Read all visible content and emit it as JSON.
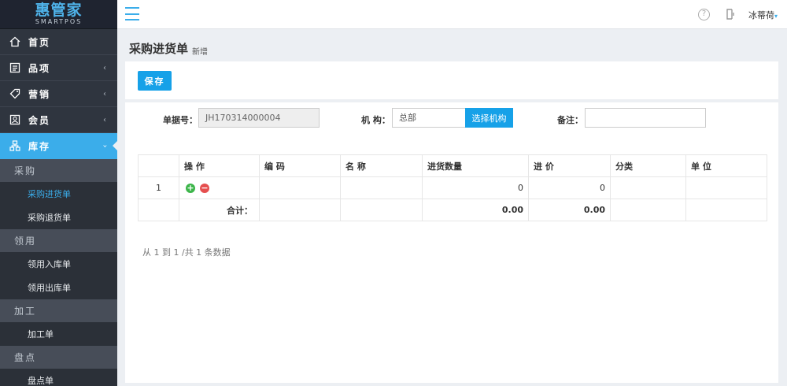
{
  "logo": {
    "main": "惠管家",
    "sub": "SMARTPOS"
  },
  "sidebar": {
    "items": [
      {
        "label": "首页",
        "icon": "home-icon",
        "arrow": ""
      },
      {
        "label": "品项",
        "icon": "list-icon",
        "arrow": "‹"
      },
      {
        "label": "营销",
        "icon": "tag-icon",
        "arrow": "‹"
      },
      {
        "label": "会员",
        "icon": "member-card-icon",
        "arrow": "‹"
      },
      {
        "label": "库存",
        "icon": "inventory-icon",
        "arrow": "›"
      }
    ],
    "inventory_menu": [
      {
        "group": "采购",
        "items": [
          "采购进货单",
          "采购退货单"
        ]
      },
      {
        "group": "领用",
        "items": [
          "领用入库单",
          "领用出库单"
        ]
      },
      {
        "group": "加工",
        "items": [
          "加工单"
        ]
      },
      {
        "group": "盘点",
        "items": [
          "盘点单"
        ]
      }
    ]
  },
  "topbar": {
    "user": "冰蒂荷",
    "help_glyph": "?"
  },
  "page": {
    "title": "采购进货单",
    "subtitle": "新增"
  },
  "toolbar": {
    "save_label": "保存"
  },
  "form": {
    "doc_no_label": "单据号：",
    "doc_no_value": "JH170314000004",
    "org_label": "机 构：",
    "org_value": "总部",
    "org_button": "选择机构",
    "remark_label": "备注：",
    "remark_value": ""
  },
  "table": {
    "headers": [
      "",
      "操 作",
      "编 码",
      "名 称",
      "进货数量",
      "进 价",
      "分类",
      "单 位"
    ],
    "rows": [
      {
        "index": "1",
        "code": "",
        "name": "",
        "qty": "0",
        "price": "0",
        "category": "",
        "unit": ""
      }
    ],
    "total": {
      "label": "合计：",
      "qty": "0.00",
      "price": "0.00"
    }
  },
  "pager": {
    "info": "从 1 到 1 /共 1 条数据"
  },
  "colors": {
    "accent": "#16a1e8",
    "sidebar_bg": "#2f353f",
    "active": "#3badea"
  }
}
